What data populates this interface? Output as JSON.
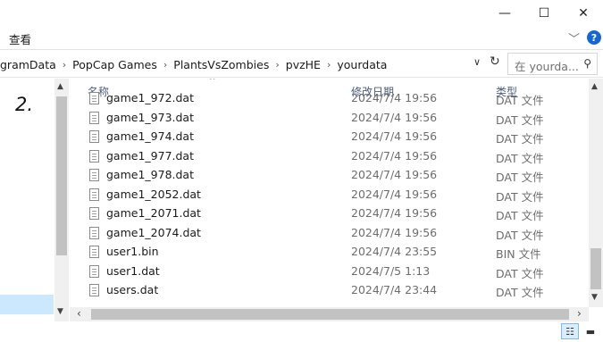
{
  "window": {
    "minimize_glyph": "—",
    "maximize_glyph": "☐",
    "close_glyph": "✕"
  },
  "ribbon": {
    "view_tab": "查看",
    "collapse_glyph": "﹀",
    "help_glyph": "?"
  },
  "address": {
    "crumbs": [
      "gramData",
      "PopCap Games",
      "PlantsVsZombies",
      "pvzHE",
      "yourdata"
    ],
    "separator": "›",
    "dropdown_glyph": "∨",
    "refresh_glyph": "↻"
  },
  "search": {
    "placeholder": "在 yourda...",
    "icon": "search-icon",
    "icon_glyph": "⚲"
  },
  "navpane": {
    "annotation": "2."
  },
  "columns": {
    "name": "名称",
    "date": "修改日期",
    "type": "类型",
    "sort_glyph": "^"
  },
  "files": [
    {
      "name": "game1_972.dat",
      "date": "2024/7/4 19:56",
      "type": "DAT 文件"
    },
    {
      "name": "game1_973.dat",
      "date": "2024/7/4 19:56",
      "type": "DAT 文件"
    },
    {
      "name": "game1_974.dat",
      "date": "2024/7/4 19:56",
      "type": "DAT 文件"
    },
    {
      "name": "game1_977.dat",
      "date": "2024/7/4 19:56",
      "type": "DAT 文件"
    },
    {
      "name": "game1_978.dat",
      "date": "2024/7/4 19:56",
      "type": "DAT 文件"
    },
    {
      "name": "game1_2052.dat",
      "date": "2024/7/4 19:56",
      "type": "DAT 文件"
    },
    {
      "name": "game1_2071.dat",
      "date": "2024/7/4 19:56",
      "type": "DAT 文件"
    },
    {
      "name": "game1_2074.dat",
      "date": "2024/7/4 19:56",
      "type": "DAT 文件"
    },
    {
      "name": "user1.bin",
      "date": "2024/7/4 23:55",
      "type": "BIN 文件"
    },
    {
      "name": "user1.dat",
      "date": "2024/7/5 1:13",
      "type": "DAT 文件"
    },
    {
      "name": "users.dat",
      "date": "2024/7/4 23:44",
      "type": "DAT 文件"
    }
  ],
  "scroll": {
    "up_glyph": "▲",
    "down_glyph": "▼",
    "left_glyph": "‹",
    "right_glyph": "›"
  },
  "statusbar": {
    "details_view_glyph": "☷",
    "tiles_view_glyph": "▬"
  },
  "colors": {
    "selection": "#cce8ff",
    "accent": "#1467d2"
  }
}
